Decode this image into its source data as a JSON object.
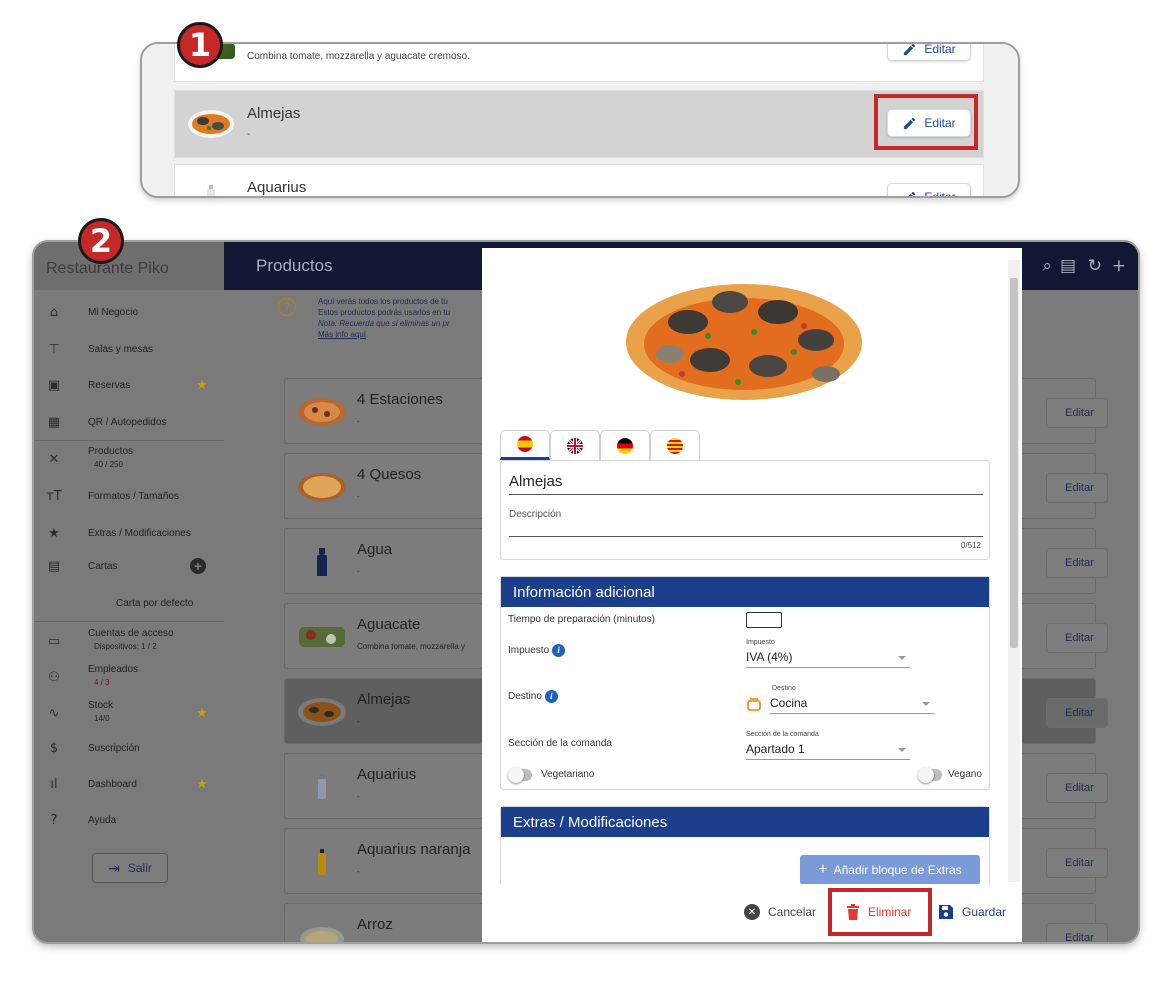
{
  "steps": [
    "1",
    "2"
  ],
  "zoom_list": {
    "rows": [
      {
        "name": "",
        "description": "Combina tomate, mozzarella y aguacate cremoso.",
        "edit_label": "Editar"
      },
      {
        "name": "Almejas",
        "description": "-",
        "edit_label": "Editar"
      },
      {
        "name": "Aquarius",
        "description": "",
        "edit_label": "Editar"
      }
    ]
  },
  "app": {
    "restaurant_name": "Restaurante Piko",
    "page_title": "Productos",
    "sidebar": {
      "items": [
        {
          "label": "Mi Negocio",
          "icon": "home-icon"
        },
        {
          "label": "Salas y mesas",
          "icon": "table-icon"
        },
        {
          "label": "Reservas",
          "icon": "calendar-icon",
          "star": true
        },
        {
          "label": "QR / Autopedidos",
          "icon": "qr-icon"
        },
        {
          "label": "Productos",
          "sub": "40 / 250",
          "icon": "cutlery-icon"
        },
        {
          "label": "Formatos / Tamaños",
          "icon": "text-size-icon"
        },
        {
          "label": "Extras / Modificaciones",
          "icon": "star-icon"
        },
        {
          "label": "Cartas",
          "icon": "menu-book-icon"
        },
        {
          "label": "Carta por defecto"
        },
        {
          "label": "Cuentas de acceso",
          "sub": "Dispositivos: 1 / 2",
          "icon": "devices-icon"
        },
        {
          "label": "Empleados",
          "sub": "4 / 3",
          "icon": "people-icon"
        },
        {
          "label": "Stock",
          "sub": "14/0",
          "icon": "trend-icon",
          "star": true
        },
        {
          "label": "Suscripción",
          "icon": "dollar-icon"
        },
        {
          "label": "Dashboard",
          "icon": "bar-chart-icon",
          "star": true
        },
        {
          "label": "Ayuda",
          "icon": "help-icon"
        }
      ],
      "logout_label": "Salir"
    },
    "info": {
      "line1": "Aquí verás todos los productos de tu",
      "line2": "Estos productos podrás usarlos en tu",
      "line3": "Nota: Recuerda que si eliminas un pr",
      "link": "Más info aquí"
    },
    "products": [
      {
        "name": "4 Estaciones",
        "description": "-",
        "edit_label": "Editar"
      },
      {
        "name": "4 Quesos",
        "description": "-",
        "edit_label": "Editar"
      },
      {
        "name": "Agua",
        "description": "-",
        "edit_label": "Editar"
      },
      {
        "name": "Aguacate",
        "description": "Combina tomate, mozzarella y",
        "edit_label": "Editar"
      },
      {
        "name": "Almejas",
        "description": "-",
        "edit_label": "Editar"
      },
      {
        "name": "Aquarius",
        "description": "-",
        "edit_label": "Editar"
      },
      {
        "name": "Aquarius naranja",
        "description": "-",
        "edit_label": "Editar"
      },
      {
        "name": "Arroz",
        "description": "",
        "edit_label": "Editar"
      }
    ]
  },
  "modal": {
    "languages": [
      "es",
      "en",
      "de",
      "ca"
    ],
    "name_value": "Almejas",
    "description_placeholder": "Descripción",
    "char_counter": "0/512",
    "additional_info": {
      "title": "Información adicional",
      "prep_time_label": "Tiempo de preparación (minutos)",
      "prep_time_value": "",
      "tax_label": "Impuesto",
      "tax_field_label": "Impuesto",
      "tax_value": "IVA (4%)",
      "destination_label": "Destino",
      "destination_field_label": "Destino",
      "destination_value": "Cocina",
      "section_label": "Sección de la comanda",
      "section_field_label": "Sección de la comanda",
      "section_value": "Apartado 1",
      "vegetarian_label": "Vegetariano",
      "vegan_label": "Vegano"
    },
    "extras": {
      "title": "Extras / Modificaciones",
      "add_button": "Añadir bloque de Extras"
    },
    "footer": {
      "cancel": "Cancelar",
      "delete": "Eliminar",
      "save": "Guardar"
    }
  },
  "colors": {
    "highlight": "#c62828",
    "navy": "#101833",
    "primary": "#1c3f8c",
    "danger": "#e53935"
  }
}
